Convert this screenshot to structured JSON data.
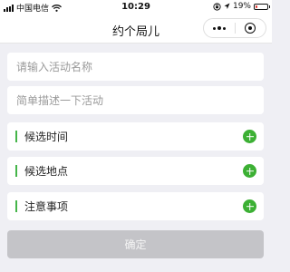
{
  "status_bar": {
    "carrier": "中国电信",
    "time": "10:29",
    "battery": "19%",
    "battery_level": 0.19,
    "battery_color": "#e0302b"
  },
  "nav": {
    "title": "约个局儿",
    "menu_icon": "more-dots-icon",
    "close_icon": "capsule-close-icon"
  },
  "form": {
    "activity_name_placeholder": "请输入活动名称",
    "description_placeholder": "简单描述一下活动",
    "options": [
      {
        "label": "候选时间",
        "icon": "add-circle-icon"
      },
      {
        "label": "候选地点",
        "icon": "add-circle-icon"
      },
      {
        "label": "注意事项",
        "icon": "add-circle-icon"
      }
    ],
    "confirm_label": "确定"
  },
  "colors": {
    "accent_green": "#44b549",
    "plus_green": "#3cb034",
    "disabled_button": "#c4c4c8",
    "page_background": "#efeff4"
  }
}
